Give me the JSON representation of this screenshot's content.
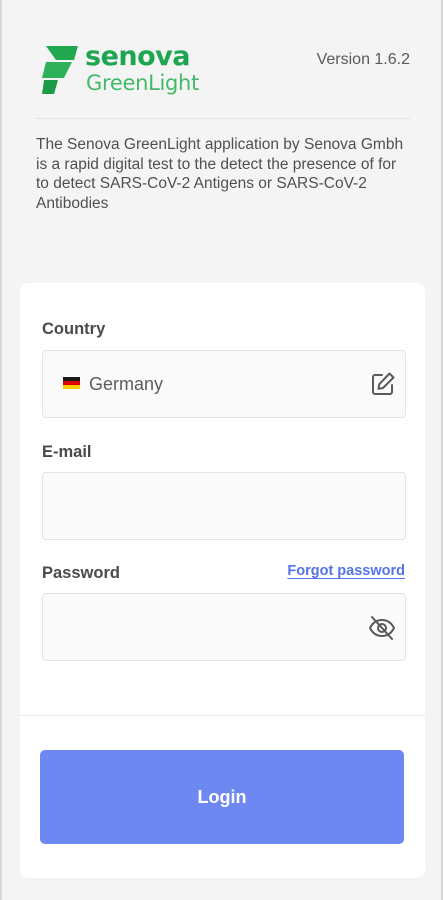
{
  "header": {
    "logo_top": "senova",
    "logo_bottom": "GreenLight",
    "version": "Version 1.6.2"
  },
  "description": "The Senova GreenLight application by Senova Gmbh is a rapid digital test to the detect the presence of for to detect SARS-CoV-2 Antigens or SARS-CoV-2 Antibodies",
  "form": {
    "country": {
      "label": "Country",
      "value": "Germany",
      "flag_icon": "germany-flag-icon",
      "action_icon": "edit-icon"
    },
    "email": {
      "label": "E-mail",
      "value": ""
    },
    "password": {
      "label": "Password",
      "value": "",
      "forgot_label": "Forgot password",
      "toggle_icon": "eye-off-icon"
    },
    "login_label": "Login"
  },
  "colors": {
    "brand_green": "#1da64f",
    "link_blue": "#5674e9",
    "button": "#6d88f0"
  }
}
